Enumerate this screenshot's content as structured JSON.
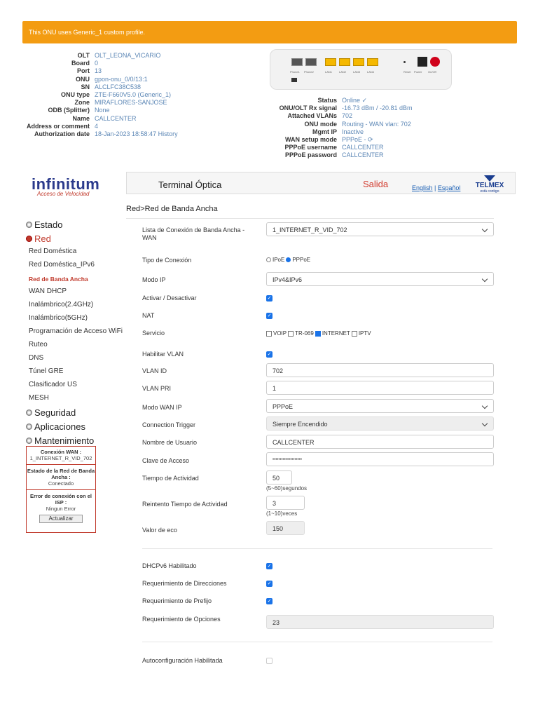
{
  "banner": "This ONU uses Generic_1 custom profile.",
  "info_left": [
    {
      "k": "OLT",
      "v": "OLT_LEONA_VICARIO"
    },
    {
      "k": "Board",
      "v": "0"
    },
    {
      "k": "Port",
      "v": "13"
    },
    {
      "k": "ONU",
      "v": "gpon-onu_0/0/13:1"
    },
    {
      "k": "SN",
      "v": "ALCLFC38C538"
    },
    {
      "k": "ONU type",
      "v": "ZTE-F660V5.0 (Generic_1)"
    },
    {
      "k": "Zone",
      "v": "MIRAFLORES-SANJOSE"
    },
    {
      "k": "ODB (Splitter)",
      "v": "None"
    },
    {
      "k": "Name",
      "v": "CALLCENTER"
    },
    {
      "k": "Address or comment",
      "v": "4"
    },
    {
      "k": "Authorization date",
      "v": "18-Jan-2023 18:58:47 History"
    }
  ],
  "info_right": [
    {
      "k": "Status",
      "v": "Online ✓"
    },
    {
      "k": "ONU/OLT Rx signal",
      "v": "-16.73 dBm / -20.81 dBm"
    },
    {
      "k": "Attached VLANs",
      "v": "702"
    },
    {
      "k": "ONU mode",
      "v": "Routing - WAN vlan: 702"
    },
    {
      "k": "Mgmt IP",
      "v": "Inactive"
    },
    {
      "k": "WAN setup mode",
      "v": "PPPoE - ⟳"
    },
    {
      "k": "PPPoE username",
      "v": "CALLCENTER"
    },
    {
      "k": "PPPoE password",
      "v": "CALLCENTER"
    }
  ],
  "device_ports": [
    "Phone1",
    "Phone2",
    "LAN1",
    "LAN2",
    "LAN3",
    "LAN4",
    "Reset",
    "Power",
    "On/Off"
  ],
  "logo": {
    "name": "infinitum",
    "tagline": "Acceso de Velocidad"
  },
  "header": {
    "title": "Terminal Óptica",
    "logout": "Salida",
    "lang_en": "English",
    "lang_sep": " | ",
    "lang_es": "Español",
    "brand": "TELMEX",
    "brand_tag": "está contigo"
  },
  "breadcrumb": "Red>Red de Banda Ancha",
  "sidebar": [
    {
      "type": "h",
      "label": "Estado"
    },
    {
      "type": "h",
      "label": "Red",
      "red": true
    },
    {
      "type": "i",
      "label": "Red Doméstica"
    },
    {
      "type": "i",
      "label": "Red Doméstica_IPv6"
    },
    {
      "type": "i",
      "label": "Red de Banda Ancha",
      "sel": true
    },
    {
      "type": "i",
      "label": "WAN DHCP"
    },
    {
      "type": "i",
      "label": "Inalámbrico(2.4GHz)"
    },
    {
      "type": "i",
      "label": "Inalámbrico(5GHz)"
    },
    {
      "type": "i",
      "label": "Programación de Acceso WiFi"
    },
    {
      "type": "i",
      "label": "Ruteo"
    },
    {
      "type": "i",
      "label": "DNS"
    },
    {
      "type": "i",
      "label": "Túnel GRE"
    },
    {
      "type": "i",
      "label": "Clasificador US"
    },
    {
      "type": "i",
      "label": "MESH"
    },
    {
      "type": "h",
      "label": "Seguridad"
    },
    {
      "type": "h",
      "label": "Aplicaciones"
    },
    {
      "type": "h",
      "label": "Mantenimiento"
    }
  ],
  "status_box": {
    "wan_label": "Conexión WAN :",
    "wan_value": "1_INTERNET_R_VID_702",
    "state_label": "Estado de la Red de Banda Ancha :",
    "state_value": "Conectado",
    "err_label": "Error de conexión con el ISP :",
    "err_value": "Ningun Error",
    "refresh": "Actualizar"
  },
  "form": {
    "wan_list_label": "Lista de Conexión de Banda Ancha - WAN",
    "wan_list_value": "1_INTERNET_R_VID_702",
    "conn_type_label": "Tipo de Conexión",
    "conn_ipoe": "IPoE",
    "conn_pppoe": "PPPoE",
    "ip_mode_label": "Modo IP",
    "ip_mode_value": "IPv4&IPv6",
    "enable_label": "Activar / Desactivar",
    "nat_label": "NAT",
    "service_label": "Servicio",
    "svc_voip": "VOIP",
    "svc_tr069": "TR-069",
    "svc_internet": "INTERNET",
    "svc_iptv": "IPTV",
    "vlan_enable_label": "Habilitar VLAN",
    "vlan_id_label": "VLAN ID",
    "vlan_id_value": "702",
    "vlan_pri_label": "VLAN PRI",
    "vlan_pri_value": "1",
    "wan_ip_mode_label": "Modo WAN IP",
    "wan_ip_mode_value": "PPPoE",
    "trigger_label": "Connection Trigger",
    "trigger_value": "Siempre Encendido",
    "user_label": "Nombre de Usuario",
    "user_value": "CALLCENTER",
    "pass_label": "Clave de Acceso",
    "pass_value": "••••••••••••••••••••",
    "active_time_label": "Tiempo de Actividad",
    "active_time_value": "50",
    "active_time_hint": "(5~60)segundos",
    "retry_label": "Reintento Tiempo de Actividad",
    "retry_value": "3",
    "retry_hint": "(1~10)veces",
    "echo_label": "Valor de eco",
    "echo_value": "150",
    "dhcpv6_label": "DHCPv6 Habilitado",
    "addr_req_label": "Requerimiento de Direcciones",
    "prefix_req_label": "Requerimiento de Prefijo",
    "opt_req_label": "Requerimiento de Opciones",
    "opt_req_value": "23",
    "autoconf_label": "Autoconfiguración Habilitada"
  },
  "colors": {
    "banner": "#f39c12",
    "accent": "#1a73e8",
    "red": "#c0392b",
    "link": "#5b86b5"
  }
}
